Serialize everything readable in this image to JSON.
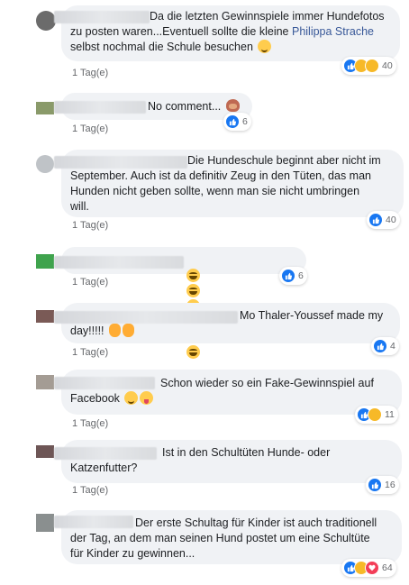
{
  "comments": [
    {
      "text_a": "Da die letzten Gewinnspiele immer Hundefotos\nzu posten waren...Eventuell sollte die kleine ",
      "mention": "Philippa Strache",
      "text_b": "\nselbst nochmal die Schule besuchen",
      "time": "1 Tag(e)",
      "reaction_count": "40",
      "reactions": [
        "like-icon",
        "haha-icon",
        "wow-icon"
      ],
      "emojis": [
        "winking-face-icon"
      ]
    },
    {
      "text": "No comment...",
      "time": "1 Tag(e)",
      "reaction_count": "6",
      "reactions": [
        "like-icon"
      ],
      "emojis": [
        "see-no-evil-monkey-icon"
      ]
    },
    {
      "text": "Die Hundeschule beginnt aber nicht im\nSeptember. Auch ist da definitiv Zeug in den Tüten, das man\nHunden nicht geben sollte, wenn man sie nicht umbringen\nwill.",
      "time": "1 Tag(e)",
      "reaction_count": "40",
      "reactions": [
        "like-icon"
      ],
      "emojis": []
    },
    {
      "text": "",
      "time": "1 Tag(e)",
      "reaction_count": "6",
      "reactions": [
        "like-icon"
      ],
      "emojis": [
        "laughing-tears-icon",
        "laughing-tears-icon",
        "laughing-tears-icon",
        "laughing-tears-icon",
        "laughing-tears-icon",
        "laughing-tears-icon"
      ]
    },
    {
      "text_a": "Mo Thaler-Youssef made my\nday!!!!!",
      "time": "1 Tag(e)",
      "reaction_count": "4",
      "reactions": [
        "like-icon"
      ],
      "emojis": [
        "clapping-hands-icon",
        "clapping-hands-icon"
      ]
    },
    {
      "text_a": "Schon wieder so ein Fake-Gewinnspiel auf\nFacebook",
      "time": "1 Tag(e)",
      "reaction_count": "11",
      "reactions": [
        "like-icon",
        "haha-icon"
      ],
      "emojis": [
        "winking-face-icon",
        "tongue-face-icon"
      ]
    },
    {
      "text": "Ist in den Schultüten Hunde- oder\nKatzenfutter?",
      "time": "1 Tag(e)",
      "reaction_count": "16",
      "reactions": [
        "like-icon"
      ],
      "emojis": []
    },
    {
      "text": "Der erste Schultag für Kinder ist auch traditionell\nder Tag, an dem man seinen Hund postet um eine Schultüte\nfür Kinder zu gewinnen...",
      "time": "1 Tag(e)",
      "reaction_count": "64",
      "reactions": [
        "like-icon",
        "haha-icon",
        "love-icon"
      ],
      "emojis": []
    }
  ],
  "colors": {
    "bubble": "#f0f2f5",
    "like": "#1877f2",
    "mention": "#385898",
    "meta": "#65676b"
  }
}
